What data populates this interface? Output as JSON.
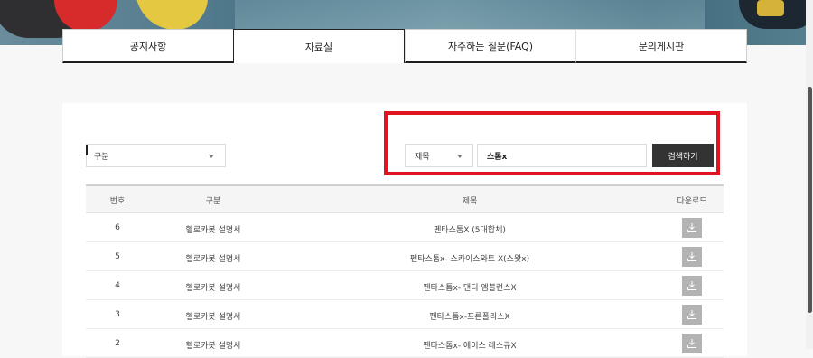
{
  "tabs": [
    {
      "label": "공지사항",
      "active": false
    },
    {
      "label": "자료실",
      "active": true
    },
    {
      "label": "자주하는 질문(FAQ)",
      "active": false
    },
    {
      "label": "문의게시판",
      "active": false
    }
  ],
  "filters": {
    "category_value": "구분",
    "field_value": "제목",
    "search_value": "스톰x",
    "search_button_label": "검색하기"
  },
  "table": {
    "headers": {
      "no": "번호",
      "category": "구분",
      "title": "제목",
      "download": "다운로드"
    },
    "rows": [
      {
        "no": "6",
        "category": "헬로카봇 설명서",
        "title": "펜타스톰X (5대합체)"
      },
      {
        "no": "5",
        "category": "헬로카봇 설명서",
        "title": "펜타스톰x- 스카이스와트 X(스왓x)"
      },
      {
        "no": "4",
        "category": "헬로카봇 설명서",
        "title": "펜타스톰x- 댄디 엠블런스X"
      },
      {
        "no": "3",
        "category": "헬로카봇 설명서",
        "title": "펜타스톰x-프론폴리스X"
      },
      {
        "no": "2",
        "category": "헬로카봇 설명서",
        "title": "펜타스톰x- 에이스 레스큐X"
      }
    ]
  },
  "colors": {
    "highlight_box": "#e0141e",
    "search_button_bg": "#333333",
    "download_button_bg": "#b3b3b3"
  },
  "icons": {
    "download": "download-icon",
    "dropdown": "chevron-down-icon"
  }
}
